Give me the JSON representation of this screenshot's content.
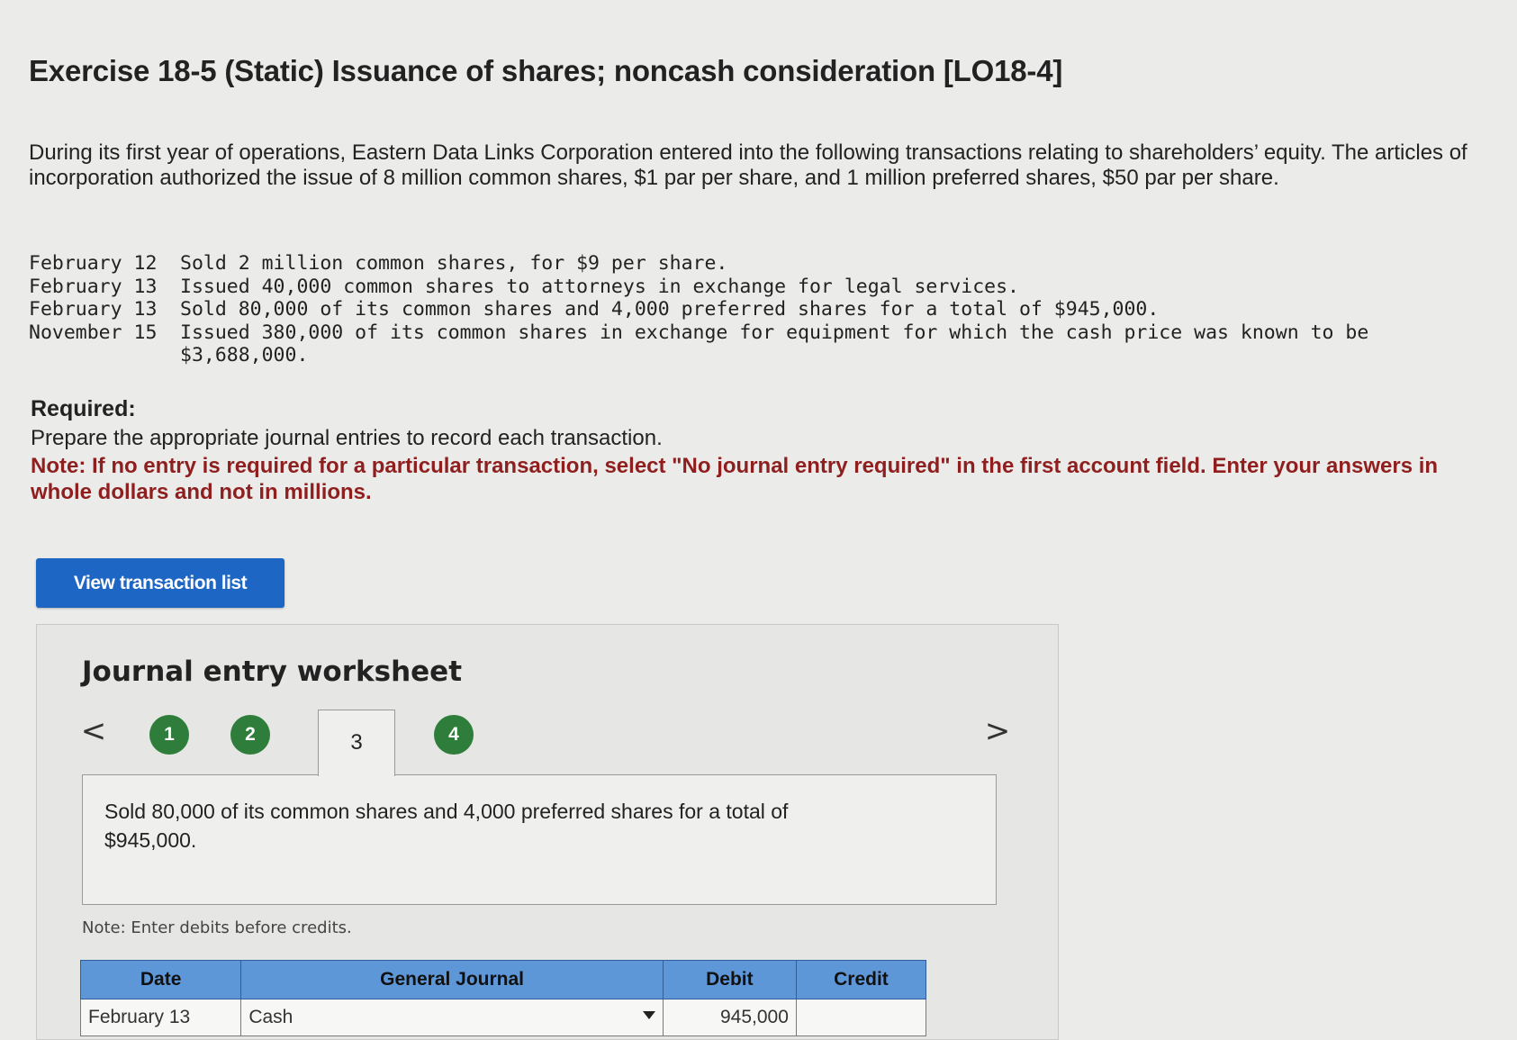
{
  "exercise": {
    "title": "Exercise 18-5 (Static) Issuance of shares; noncash consideration [LO18-4]",
    "intro": "During its first year of operations, Eastern Data Links Corporation entered into the following transactions relating to shareholders’ equity. The articles of incorporation authorized the issue of 8 million common shares, $1 par per share, and 1 million preferred shares, $50 par per share."
  },
  "transactions": [
    {
      "date": "February 12",
      "text": "Sold 2 million common shares, for $9 per share."
    },
    {
      "date": "February 13",
      "text": "Issued 40,000 common shares to attorneys in exchange for legal services."
    },
    {
      "date": "February 13",
      "text": "Sold 80,000 of its common shares and 4,000 preferred shares for a total of $945,000."
    },
    {
      "date": "November 15",
      "text": "Issued 380,000 of its common shares in exchange for equipment for which the cash price was known to be $3,688,000."
    }
  ],
  "required": {
    "label": "Required:",
    "text": "Prepare the appropriate journal entries to record each transaction.",
    "note": "Note: If no entry is required for a particular transaction, select \"No journal entry required\" in the first account field. Enter your answers in whole dollars and not in millions."
  },
  "view_button_label": "View transaction list",
  "worksheet": {
    "title": "Journal entry worksheet",
    "prev_glyph": "<",
    "next_glyph": ">",
    "steps": [
      {
        "label": "1",
        "status": "complete"
      },
      {
        "label": "2",
        "status": "complete"
      },
      {
        "label": "3",
        "status": "active"
      },
      {
        "label": "4",
        "status": "complete"
      }
    ],
    "step_complete_color": "#2f7d3b",
    "description": "Sold 80,000 of its common shares and 4,000 preferred shares for a total of $945,000.",
    "debits_note": "Note: Enter debits before credits.",
    "table": {
      "headers": {
        "date": "Date",
        "journal": "General Journal",
        "debit": "Debit",
        "credit": "Credit"
      },
      "header_color": "#5e97d8",
      "rows": [
        {
          "date": "February 13",
          "account": "Cash",
          "debit": "945,000",
          "credit": ""
        }
      ]
    }
  }
}
